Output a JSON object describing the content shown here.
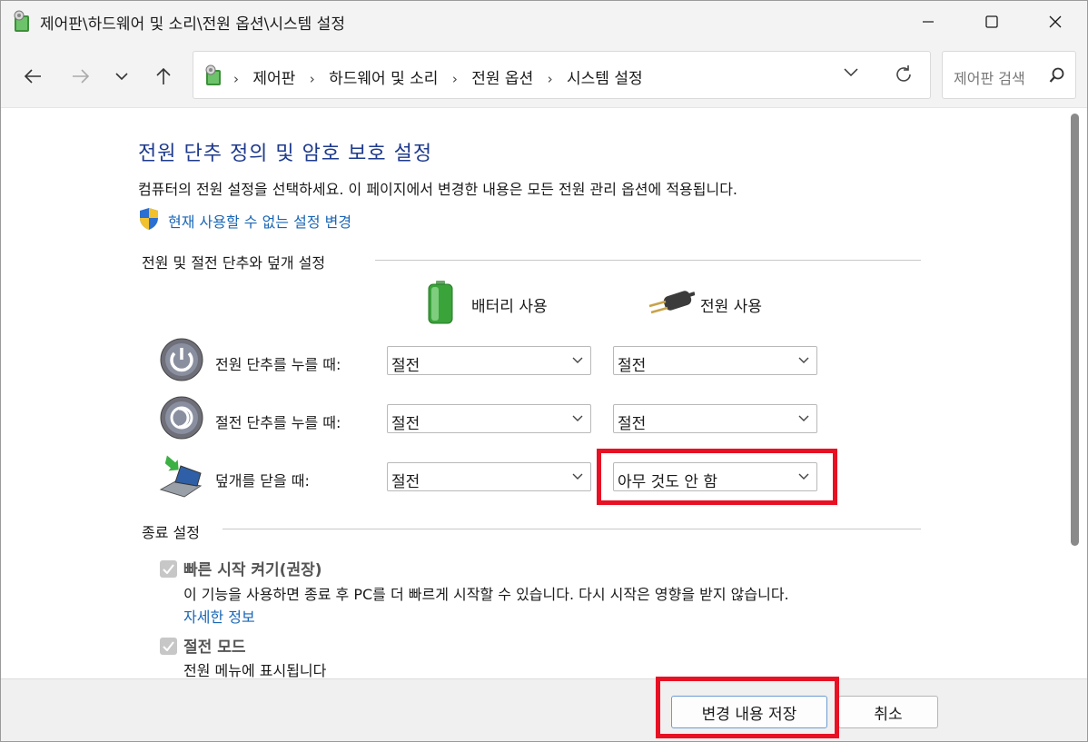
{
  "window": {
    "title": "제어판\\하드웨어 및 소리\\전원 옵션\\시스템 설정"
  },
  "nav": {
    "breadcrumbs": [
      "제어판",
      "하드웨어 및 소리",
      "전원 옵션",
      "시스템 설정"
    ],
    "search_placeholder": "제어판 검색"
  },
  "main": {
    "title": "전원 단추 정의 및 암호 보호 설정",
    "description": "컴퓨터의 전원 설정을 선택하세요. 이 페이지에서 변경한 내용은 모든 전원 관리 옵션에 적용됩니다.",
    "change_link": "현재 사용할 수 없는 설정 변경",
    "section_power": "전원 및 절전 단추와 덮개 설정",
    "col_battery": "배터리 사용",
    "col_ac": "전원 사용",
    "rows": [
      {
        "label": "전원 단추를 누를 때:",
        "battery": "절전",
        "ac": "절전"
      },
      {
        "label": "절전 단추를 누를 때:",
        "battery": "절전",
        "ac": "절전"
      },
      {
        "label": "덮개를 닫을 때:",
        "battery": "절전",
        "ac": "아무 것도 안 함"
      }
    ],
    "section_shutdown": "종료 설정",
    "fast_startup": {
      "label": "빠른 시작 켜기(권장)",
      "desc": "이 기능을 사용하면 종료 후 PC를 더 빠르게 시작할 수 있습니다. 다시 시작은 영향을 받지 않습니다.",
      "more": "자세한 정보",
      "checked": true
    },
    "sleep_mode": {
      "label": "절전 모드",
      "desc": "전원 메뉴에 표시됩니다",
      "checked": true
    }
  },
  "footer": {
    "save_label": "변경 내용 저장",
    "cancel_label": "취소"
  },
  "colors": {
    "title_blue": "#1e3a8c",
    "link_blue": "#1a66b5",
    "highlight_red": "#e81123"
  }
}
